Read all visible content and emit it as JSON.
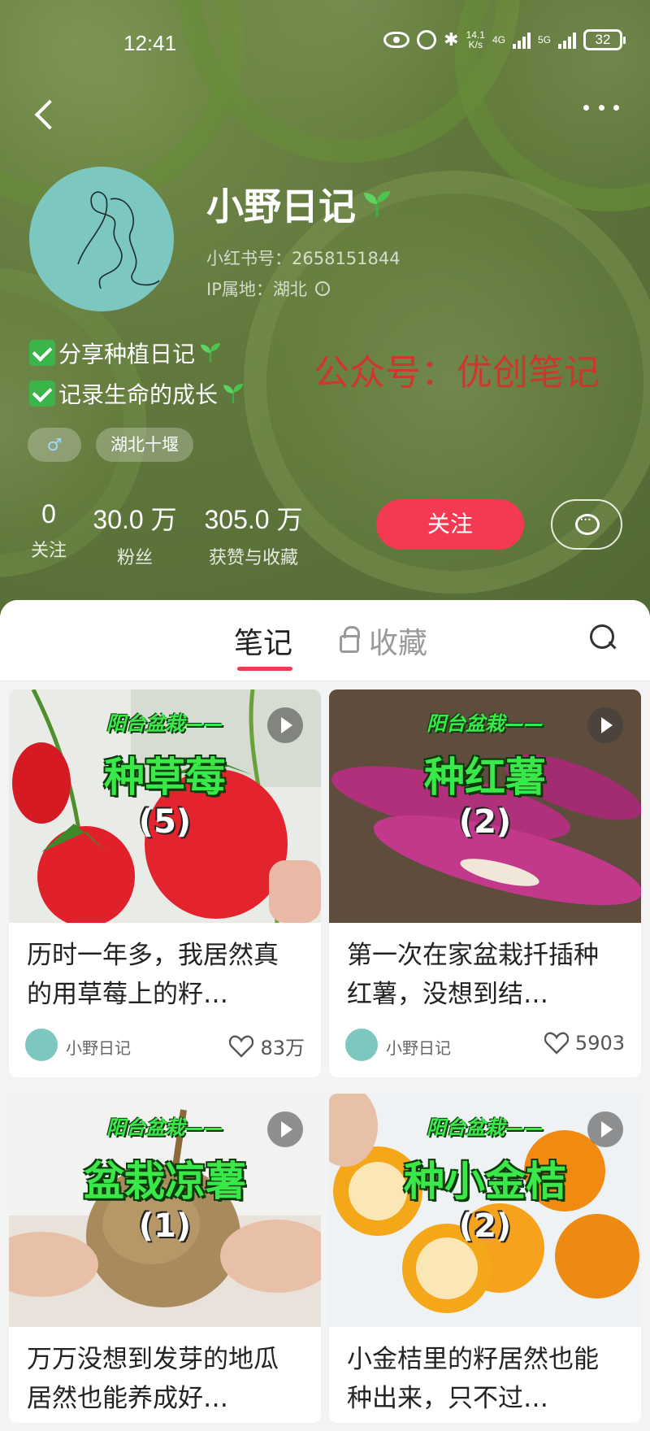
{
  "status_bar": {
    "time": "12:41",
    "net_speed_top": "14.1",
    "net_speed_unit": "K/s",
    "net_4g": "4G",
    "net_5g": "5G",
    "battery": "32"
  },
  "profile": {
    "name": "小野日记",
    "id_line": "小红书号：2658151844",
    "ip_line": "IP属地：湖北",
    "bio": [
      "分享种植日记",
      "记录生命的成长"
    ],
    "watermark": "公众号：优创笔记",
    "gender_tag": "♂",
    "location_tag": "湖北十堰",
    "stats": [
      {
        "num": "0",
        "label": "关注"
      },
      {
        "num": "30.0 万",
        "label": "粉丝"
      },
      {
        "num": "305.0 万",
        "label": "获赞与收藏"
      }
    ],
    "follow_label": "关注",
    "accent": "#f43a52"
  },
  "tabs": {
    "notes": "笔记",
    "favorites": "收藏"
  },
  "notes": [
    {
      "overlay_sub": "阳台盆栽——",
      "overlay_main": "种草莓",
      "overlay_num": "(5)",
      "title": "历时一年多，我居然真的用草莓上的籽…",
      "author": "小野日记",
      "likes": "83万",
      "theme": "strawberry"
    },
    {
      "overlay_sub": "阳台盆栽——",
      "overlay_main": "种红薯",
      "overlay_num": "(2)",
      "title": "第一次在家盆栽扦插种红薯，没想到结…",
      "author": "小野日记",
      "likes": "5903",
      "theme": "sweetpotato"
    },
    {
      "overlay_sub": "阳台盆栽——",
      "overlay_main": "盆栽凉薯",
      "overlay_num": "(1)",
      "title": "万万没想到发芽的地瓜居然也能养成好…",
      "author": "小野日记",
      "likes": "",
      "theme": "jicama"
    },
    {
      "overlay_sub": "阳台盆栽——",
      "overlay_main": "种小金桔",
      "overlay_num": "(2)",
      "title": "小金桔里的籽居然也能种出来，只不过…",
      "author": "小野日记",
      "likes": "",
      "theme": "kumquat"
    }
  ]
}
